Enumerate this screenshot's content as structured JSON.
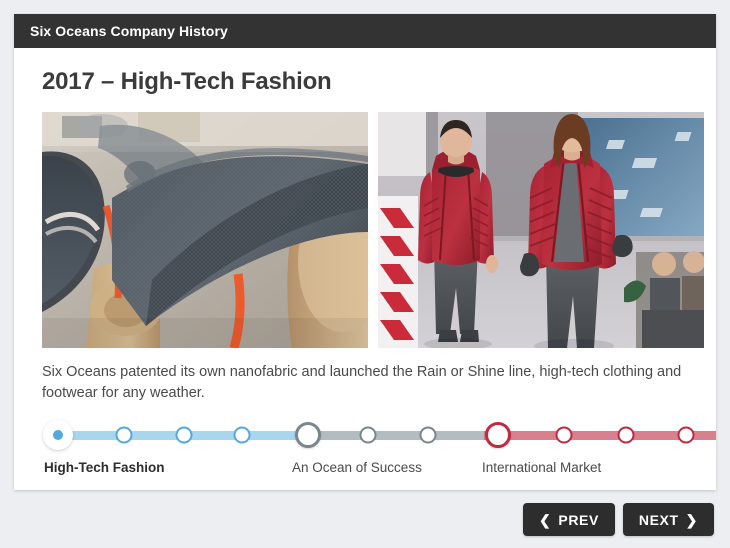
{
  "window": {
    "title": "Six Oceans Company History"
  },
  "slide": {
    "title": "2017 – High-Tech Fashion",
    "caption": "Six Oceans patented its own nanofabric and launched the Rain or Shine line, high-tech clothing and footwear for any weather.",
    "images": [
      {
        "alt": "Rolls of dark gray technical nanofabric stacked on cardboard cores with orange straps",
        "name": "nanofabric-roll-photo"
      },
      {
        "alt": "Two models walking a fashion runway wearing red high-tech jackets and gray pants",
        "name": "runway-models-photo"
      }
    ]
  },
  "timeline": {
    "sections": [
      {
        "label": "High-Tech Fashion",
        "color": "#55a8dc",
        "track_color": "#a9d6ef",
        "state": "current",
        "steps": 4
      },
      {
        "label": "An Ocean of Success",
        "color": "#7b868c",
        "track_color": "#b3bcc1",
        "state": "upcoming",
        "steps": 3
      },
      {
        "label": "International Market",
        "color": "#c0293f",
        "track_color": "#d9808e",
        "state": "upcoming",
        "steps": 4
      }
    ]
  },
  "nav": {
    "prev_label": "PREV",
    "next_label": "NEXT",
    "prev_icon": "chevron-left-icon",
    "next_icon": "chevron-right-icon"
  },
  "colors": {
    "page_background": "#eceef1",
    "card_background": "#ffffff",
    "titlebar": "#333333",
    "button": "#2d2d2d",
    "accent_blue": "#55a8dc",
    "accent_gray": "#7b868c",
    "accent_red": "#c0293f"
  }
}
